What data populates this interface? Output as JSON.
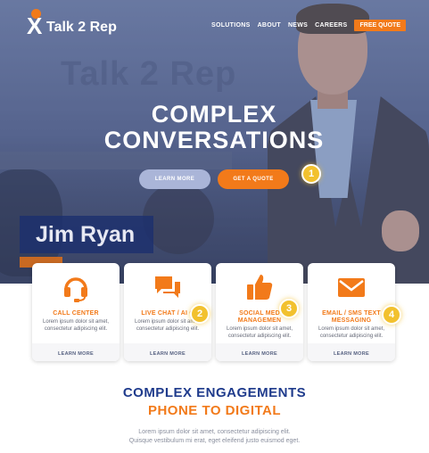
{
  "brand": {
    "logo_text": "Talk 2 Rep",
    "watermark": "Talk 2 Rep",
    "accent": "#f27a1a",
    "navy": "#1f3b8c",
    "marker": "#f2c12e"
  },
  "nav": {
    "items": [
      "SOLUTIONS",
      "ABOUT",
      "NEWS",
      "CAREERS"
    ],
    "cta": "FREE QUOTE"
  },
  "hero": {
    "title_line1": "COMPLEX",
    "title_line2": "CONVERSATIONS",
    "learn_more": "LEARN MORE",
    "get_quote": "GET A QUOTE",
    "presenter_name": "Jim Ryan"
  },
  "markers": [
    "1",
    "2",
    "3",
    "4"
  ],
  "cards": [
    {
      "icon": "headset-icon",
      "title_line1": "CALL CENTER",
      "title_line2": "",
      "text": "Lorem ipsum dolor sit amet, consectetur adipiscing elit.",
      "link": "LEARN MORE"
    },
    {
      "icon": "chat-bubbles-icon",
      "title_line1": "LIVE CHAT / AI C",
      "title_line2": "",
      "text": "Lorem ipsum dolor sit amet, consectetur adipiscing elit.",
      "link": "LEARN MORE"
    },
    {
      "icon": "thumbs-up-icon",
      "title_line1": "SOCIAL MED",
      "title_line2": "MANAGEMEN",
      "text": "Lorem ipsum dolor sit amet, consectetur adipiscing elit.",
      "link": "LEARN MORE"
    },
    {
      "icon": "envelope-icon",
      "title_line1": "EMAIL / SMS TEXT",
      "title_line2": "MESSAGING",
      "text": "Lorem ipsum dolor sit amet, consectetur adipiscing elit.",
      "link": "LEARN MORE"
    }
  ],
  "section": {
    "title_line1": "COMPLEX ENGAGEMENTS",
    "title_line2": "PHONE TO DIGITAL",
    "text_line1": "Lorem ipsum dolor sit amet, consectetur adipiscing elit.",
    "text_line2": "Quisque vestibulum mi erat, eget eleifend justo euismod eget."
  }
}
